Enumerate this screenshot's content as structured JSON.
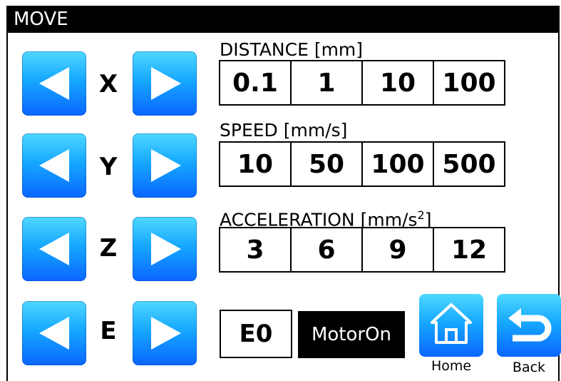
{
  "window": {
    "title": "MOVE"
  },
  "axes": [
    {
      "label": "X"
    },
    {
      "label": "Y"
    },
    {
      "label": "Z"
    },
    {
      "label": "E"
    }
  ],
  "distance": {
    "label": "DISTANCE [mm]",
    "options": [
      "0.1",
      "1",
      "10",
      "100"
    ]
  },
  "speed": {
    "label": "SPEED [mm/s]",
    "options": [
      "10",
      "50",
      "100",
      "500"
    ]
  },
  "acceleration": {
    "label_main": "ACCELERATION [mm/s",
    "label_sup": "2",
    "label_end": "]",
    "options": [
      "3",
      "6",
      "9",
      "12"
    ]
  },
  "extruder": {
    "label": "E0"
  },
  "motor": {
    "label": "MotorOn"
  },
  "nav": {
    "home_label": "Home",
    "back_label": "Back"
  },
  "icons": {
    "jog_left": "left-arrow-icon",
    "jog_right": "right-arrow-icon",
    "home": "home-icon",
    "back": "back-arrow-icon"
  },
  "colors": {
    "button_top": "#4fd8ff",
    "button_bottom": "#0a66ff",
    "titlebar": "#000000"
  }
}
